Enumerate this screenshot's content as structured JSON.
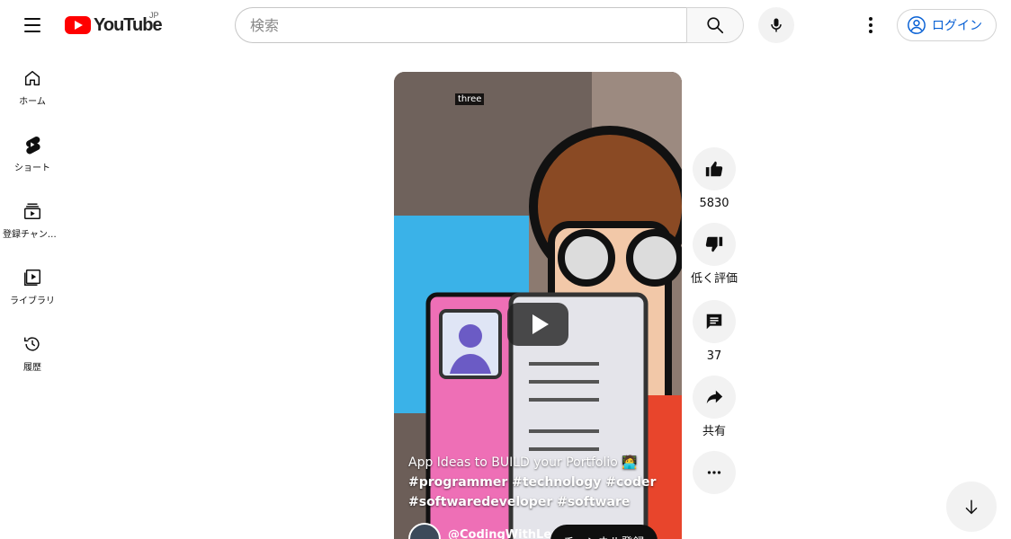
{
  "header": {
    "logo_text": "YouTube",
    "logo_region": "JP",
    "search_placeholder": "検索",
    "login_label": "ログイン"
  },
  "sidebar": {
    "items": [
      {
        "label": "ホーム",
        "icon": "home-icon"
      },
      {
        "label": "ショート",
        "icon": "shorts-icon"
      },
      {
        "label": "登録チャンネル",
        "icon": "subscriptions-icon"
      },
      {
        "label": "ライブラリ",
        "icon": "library-icon"
      },
      {
        "label": "履歴",
        "icon": "history-icon"
      }
    ]
  },
  "video": {
    "overlay_tag": "three",
    "title": "App Ideas to BUILD your Portfolio 🧑‍💻",
    "hashtags": "#programmer #technology #coder #softwaredeveloper #software",
    "channel": "@CodingWithLewi",
    "subscribe_label": "チャンネル登録"
  },
  "actions": {
    "like_count": "5830",
    "dislike_label": "低く評価",
    "comment_count": "37",
    "share_label": "共有"
  },
  "colors": {
    "brand_red": "#ff0000",
    "link_blue": "#065fd4",
    "button_gray": "#f2f2f2"
  }
}
